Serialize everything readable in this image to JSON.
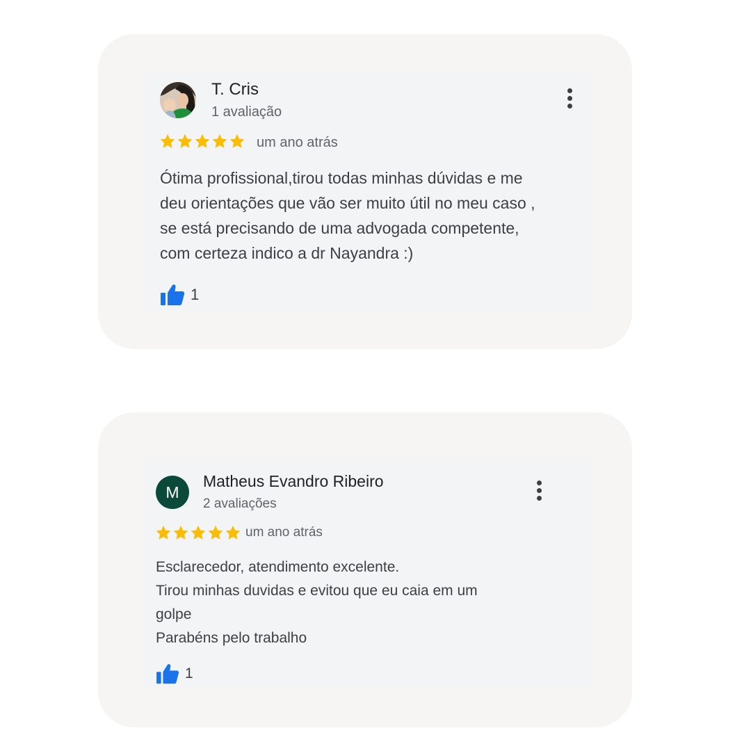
{
  "colors": {
    "star": "#fbbc04",
    "like": "#1a73e8",
    "avatar_letter_bg": "#0b4a3a"
  },
  "reviews": [
    {
      "author": "T. Cris",
      "review_count": "1 avaliação",
      "avatar": "profile-photo",
      "rating": 5,
      "time": "um ano atrás",
      "text_lines": [
        "Ótima profissional,tirou todas minhas dúvidas e me",
        "deu orientações que vão ser muito útil no meu caso ,",
        "se está precisando de uma advogada competente,",
        "com certeza indico a dr Nayandra :)"
      ],
      "likes": "1",
      "icons": {
        "menu": "more-vert-icon",
        "like": "thumbs-up-icon",
        "star": "star-icon"
      }
    },
    {
      "author": "Matheus Evandro Ribeiro",
      "review_count": "2 avaliações",
      "avatar_letter": "M",
      "rating": 5,
      "time": "um ano atrás",
      "text_lines": [
        "Esclarecedor, atendimento excelente.",
        "Tirou minhas duvidas e evitou que eu caia em um",
        "golpe",
        "Parabéns pelo trabalho"
      ],
      "likes": "1",
      "icons": {
        "menu": "more-vert-icon",
        "like": "thumbs-up-icon",
        "star": "star-icon"
      }
    }
  ]
}
